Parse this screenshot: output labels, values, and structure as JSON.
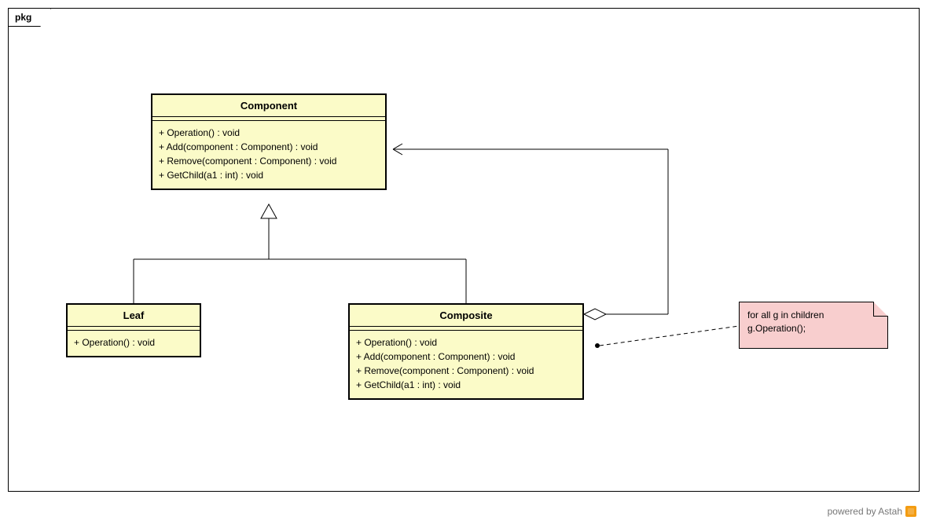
{
  "frame": {
    "label": "pkg"
  },
  "classes": {
    "component": {
      "name": "Component",
      "members": [
        "+ Operation() : void",
        "+ Add(component : Component) : void",
        "+ Remove(component : Component) : void",
        "+ GetChild(a1 : int) : void"
      ]
    },
    "leaf": {
      "name": "Leaf",
      "members": [
        "+ Operation() : void"
      ]
    },
    "composite": {
      "name": "Composite",
      "members": [
        "+ Operation() : void",
        "+ Add(component : Component) : void",
        "+ Remove(component : Component) : void",
        "+ GetChild(a1 : int) : void"
      ]
    }
  },
  "note": {
    "line1": "for all g in children",
    "line2": "g.Operation();"
  },
  "footer": {
    "text": "powered by Astah"
  },
  "relations": [
    {
      "type": "generalization",
      "from": "Leaf",
      "to": "Component"
    },
    {
      "type": "generalization",
      "from": "Composite",
      "to": "Component"
    },
    {
      "type": "aggregation",
      "from": "Composite",
      "to": "Component"
    },
    {
      "type": "note-link",
      "from": "Note",
      "to": "Composite.Operation"
    }
  ]
}
